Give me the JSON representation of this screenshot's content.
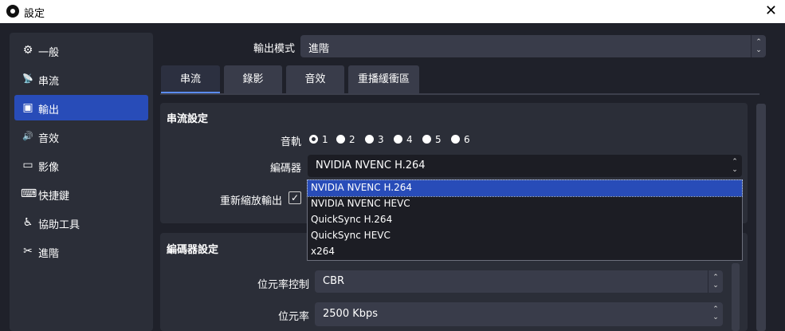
{
  "window": {
    "title": "設定",
    "close_glyph": "✕"
  },
  "sidebar": {
    "items": [
      {
        "label": "一般",
        "icon": "gear-icon",
        "glyph": "⚙"
      },
      {
        "label": "串流",
        "icon": "antenna-icon",
        "glyph": "📡"
      },
      {
        "label": "輸出",
        "icon": "output-icon",
        "glyph": "▣"
      },
      {
        "label": "音效",
        "icon": "speaker-icon",
        "glyph": "🔊"
      },
      {
        "label": "影像",
        "icon": "monitor-icon",
        "glyph": "▭"
      },
      {
        "label": "快捷鍵",
        "icon": "keyboard-icon",
        "glyph": "⌨"
      },
      {
        "label": "協助工具",
        "icon": "accessibility-icon",
        "glyph": "♿"
      },
      {
        "label": "進階",
        "icon": "tools-icon",
        "glyph": "✂"
      }
    ],
    "active_index": 2
  },
  "output_mode": {
    "label": "輸出模式",
    "value": "進階"
  },
  "tabs": [
    {
      "label": "串流"
    },
    {
      "label": "錄影"
    },
    {
      "label": "音效"
    },
    {
      "label": "重播緩衝區"
    }
  ],
  "streaming": {
    "title": "串流設定",
    "audio_track_label": "音軌",
    "tracks": [
      "1",
      "2",
      "3",
      "4",
      "5",
      "6"
    ],
    "selected_track": "1",
    "encoder_label": "編碼器",
    "encoder_value": "NVIDIA NVENC H.264",
    "rescale_label": "重新縮放輸出",
    "rescale_checked": true,
    "check_glyph": "✓"
  },
  "encoder_dropdown": {
    "options": [
      "NVIDIA NVENC H.264",
      "NVIDIA NVENC HEVC",
      "QuickSync H.264",
      "QuickSync HEVC",
      "x264"
    ],
    "highlighted_index": 0
  },
  "encoder_settings": {
    "title": "編碼器設定",
    "rate_control_label": "位元率控制",
    "rate_control_value": "CBR",
    "bitrate_label": "位元率",
    "bitrate_value": "2500 Kbps"
  },
  "spinner": {
    "up": "⌃",
    "down": "⌄"
  },
  "colors": {
    "accent": "#284cb8",
    "background": "#1f212a",
    "panel": "#2b2e38",
    "control": "#393c4a"
  }
}
